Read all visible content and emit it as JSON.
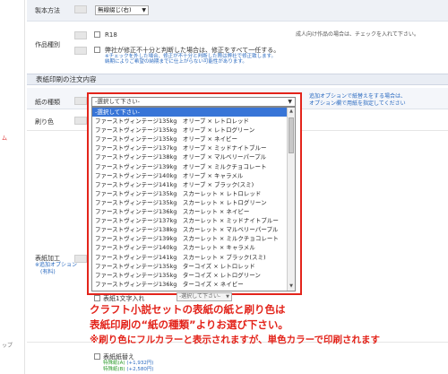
{
  "left_panel": {
    "red_text": "ム",
    "bottom_text": "ップ"
  },
  "rows": {
    "binding": {
      "label": "製本方法",
      "select_value": "無線綴じ(右)"
    },
    "genre": {
      "label": "作品種別",
      "r18_label": "R18",
      "r18_note": "成人向け作品の場合は、チェックを入れて下さい。",
      "fix_label": "弊社が修正不十分と判断した場合は、修正をすべて一任する。",
      "fix_note_1": "※チェックを外した場合、修正が不十分と判断した際は弊社で修正致します。",
      "fix_note_2": "納期によりご希望の納期までに仕上がらない可能性があります。"
    }
  },
  "section_title": "表紙印刷の注文内容",
  "paper": {
    "label": "紙の種類",
    "select_value": "-選択して下さい-",
    "note_1": "追加オプションで紙替えをする場合は、",
    "note_2": "オプション欄で用紙を指定してください"
  },
  "color_label": "刷り色",
  "hyoshi_kako": {
    "label": "表紙加工",
    "note": "※追加オプション",
    "note_sub": "(有料)"
  },
  "dropdown": {
    "placeholder": "-選択して下さい-",
    "options": [
      "-選択して下さい-",
      "ファーストヴィンテージ135kg　オリーブ × レトロレッド",
      "ファーストヴィンテージ135kg　オリーブ × レトログリーン",
      "ファーストヴィンテージ135kg　オリーブ × ネイビー",
      "ファーストヴィンテージ137kg　オリーブ × ミッドナイトブルー",
      "ファーストヴィンテージ138kg　オリーブ × マルベリーパープル",
      "ファーストヴィンテージ139kg　オリーブ × ミルクチョコレート",
      "ファーストヴィンテージ140kg　オリーブ × キャラメル",
      "ファーストヴィンテージ141kg　オリーブ × ブラック(スミ)",
      "ファーストヴィンテージ135kg　スカーレット × レトロレッド",
      "ファーストヴィンテージ135kg　スカーレット × レトログリーン",
      "ファーストヴィンテージ136kg　スカーレット × ネイビー",
      "ファーストヴィンテージ137kg　スカーレット × ミッドナイトブルー",
      "ファーストヴィンテージ138kg　スカーレット × マルベリーパープル",
      "ファーストヴィンテージ139kg　スカーレット × ミルクチョコレート",
      "ファーストヴィンテージ140kg　スカーレット × キャラメル",
      "ファーストヴィンテージ141kg　スカーレット × ブラック(スミ)",
      "ファーストヴィンテージ135kg　ターコイズ × レトロレッド",
      "ファーストヴィンテージ135kg　ターコイズ × レトログリーン",
      "ファーストヴィンテージ136kg　ターコイズ × ネイビー"
    ]
  },
  "hyoshi_moji": {
    "label": "表紙1文字入れ",
    "select_value": "-選択して下さい-"
  },
  "notice": {
    "line1": "クラフト小説セットの表紙の紙と刷り色は",
    "line2": "表紙印刷の“紙の種類”よりお選び下さい。",
    "line3": "※刷り色にフルカラーと表示されますが、単色カラーで印刷されます"
  },
  "paper_change": {
    "label": "表紙紙替え",
    "price1_label": "特殊紙(A)",
    "price1_value": "(+1,932円)",
    "price2_label": "特殊紙(B)",
    "price2_value": "(+2,580円)"
  },
  "colors": {
    "accent_red": "#e3241b",
    "link_blue": "#2a6ac0",
    "selected_blue": "#3875d7"
  }
}
